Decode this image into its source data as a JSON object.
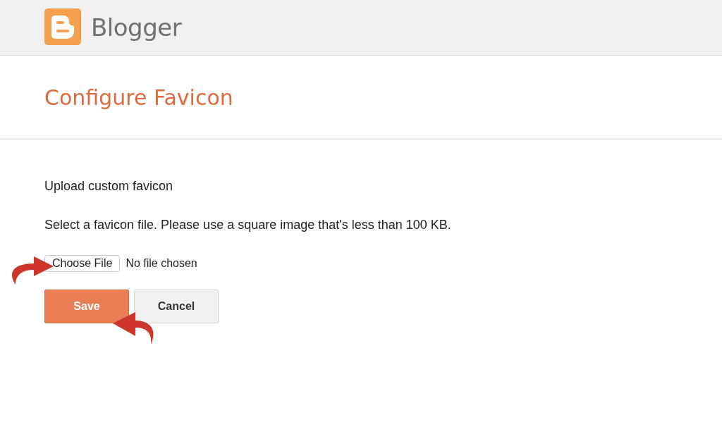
{
  "header": {
    "brand": "Blogger"
  },
  "page": {
    "title": "Configure Favicon"
  },
  "form": {
    "heading": "Upload custom favicon",
    "instruction": "Select a favicon file. Please use a square image that's less than 100 KB.",
    "file_input": {
      "button": "Choose File",
      "status": "No file chosen"
    },
    "buttons": [
      {
        "label": "Save",
        "kind": "primary"
      },
      {
        "label": "Cancel",
        "kind": "secondary"
      }
    ]
  }
}
